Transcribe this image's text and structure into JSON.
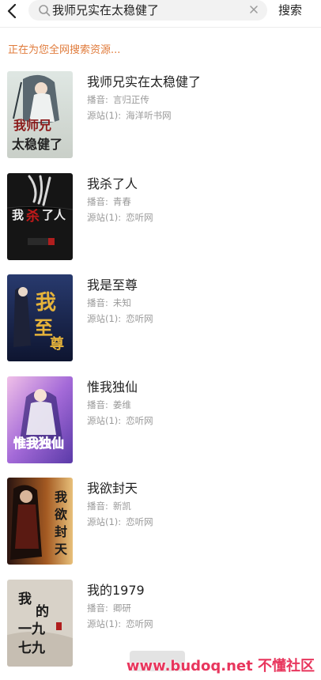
{
  "header": {
    "back_icon": "chevron-left-icon",
    "search_value": "我师兄实在太稳健了",
    "search_button": "搜索"
  },
  "status_text": "正在为您全网搜索资源...",
  "results": [
    {
      "title": "我师兄实在太稳健了",
      "narrator_label": "播音:",
      "narrator": "言归正传",
      "source_label": "源站(1):",
      "source": "海洋听书网",
      "cover_text": "我师兄实在太稳健了"
    },
    {
      "title": "我杀了人",
      "narrator_label": "播音:",
      "narrator": "青春",
      "source_label": "源站(1):",
      "source": "恋听网",
      "cover_text": "我杀了人"
    },
    {
      "title": "我是至尊",
      "narrator_label": "播音:",
      "narrator": "未知",
      "source_label": "源站(1):",
      "source": "恋听网",
      "cover_text": "我是至尊"
    },
    {
      "title": "惟我独仙",
      "narrator_label": "播音:",
      "narrator": "姜维",
      "source_label": "源站(1):",
      "source": "恋听网",
      "cover_text": "惟我独仙"
    },
    {
      "title": "我欲封天",
      "narrator_label": "播音:",
      "narrator": "新凯",
      "source_label": "源站(1):",
      "source": "恋听网",
      "cover_text": "我欲封天"
    },
    {
      "title": "我的1979",
      "narrator_label": "播音:",
      "narrator": "卿研",
      "source_label": "源站(1):",
      "source": "恋听网",
      "cover_text": "我的1979"
    }
  ],
  "watermark": "www.budoq.net 不懂社区",
  "colors": {
    "status": "#e07b3b",
    "watermark": "#e8365d"
  }
}
